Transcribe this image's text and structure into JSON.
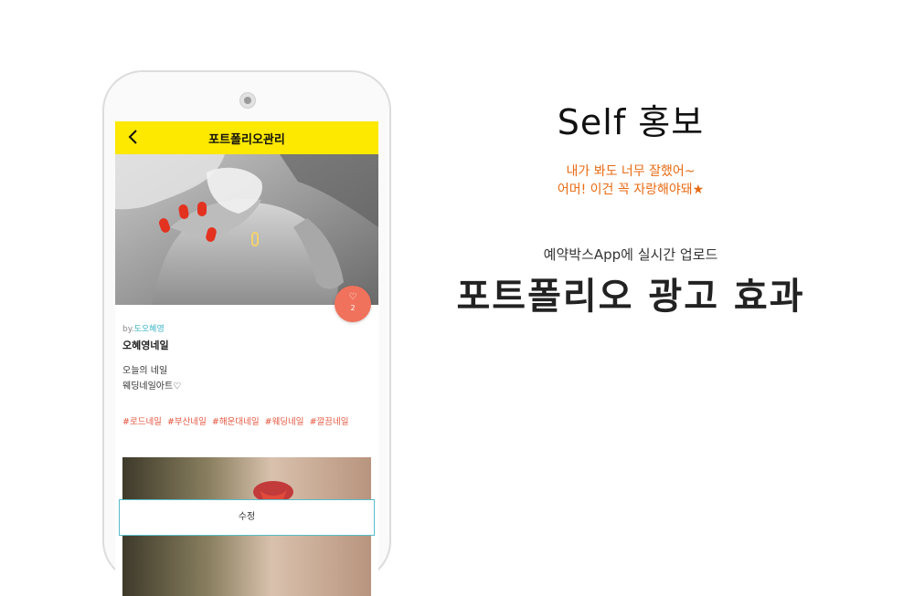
{
  "app": {
    "title": "포트폴리오관리",
    "post": {
      "by_prefix": "by.",
      "author": "도오혜영",
      "shop_name": "오혜영네일",
      "description_lines": [
        "오늘의 네일",
        "웨딩네일아트♡"
      ],
      "tags": [
        "#로드네일",
        "#부산네일",
        "#해운대네일",
        "#웨딩네일",
        "#깔끔네일"
      ],
      "like_count": "2"
    },
    "edit_label": "수정"
  },
  "marketing": {
    "headline": "Self 홍보",
    "tagline_lines": [
      "내가 봐도 너무 잘했어~",
      "어머! 이건 꼭 자랑해야돼★"
    ],
    "subhead": "예약박스App에 실시간 업로드",
    "big_title": "포트폴리오 광고 효과"
  },
  "colors": {
    "appbar": "#fde800",
    "accent_orange": "#e86a12",
    "like": "#f0725c",
    "tag": "#e4573f",
    "author": "#3bb4c6",
    "edit_border": "#58bcc9"
  }
}
